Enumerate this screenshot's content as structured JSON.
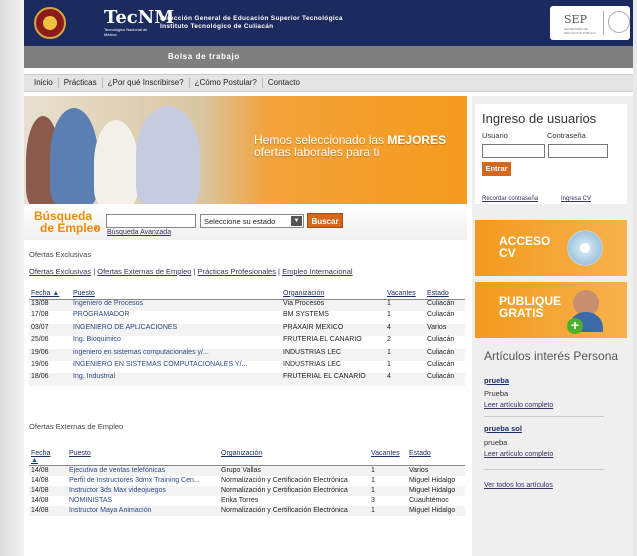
{
  "header": {
    "tecnm_mark": "TecNM",
    "tecnm_text": "Tecnológico Nacional de México",
    "title_line1": "Dirección General de Educación Superior Tecnológica",
    "title_line2": "Instituto Tecnológico de Culiacán",
    "sep_label": "SEP",
    "sep_sub": "SECRETARÍA DE EDUCACIÓN PÚBLICA"
  },
  "bolsa_title": "Bolsa de trabajo",
  "nav": [
    "Inicio",
    "Prácticas",
    "¿Por qué Inscribirse?",
    "¿Cómo Postular?",
    "Contacto"
  ],
  "banner": {
    "line1_prefix": "Hemos seleccionado las ",
    "line1_strong": "MEJORES",
    "line2": "ofertas laborales para ti"
  },
  "search": {
    "title_line1": "Búsqueda",
    "title_line2": "de Empleo",
    "chevron": "»",
    "advanced": "Búsqueda Avanzada",
    "state_placeholder": "Seleccione su estado",
    "button": "Buscar"
  },
  "exclusivas": {
    "title": "Ofertas Exclusivas",
    "filters": [
      "Ofertas Exclusivas",
      "Ofertas Externas de Empleo",
      "Prácticas Profesionales",
      "Empleo Internacional"
    ],
    "columns": [
      "Fecha",
      "Puesto",
      "Organización",
      "Vacantes",
      "Estado"
    ],
    "sort_arrow": "▲",
    "rows": [
      [
        "13/08",
        "Ingeniero de Procesos",
        "Via Procesos",
        "1",
        "Culiacán"
      ],
      [
        "17/08",
        "PROGRAMADOR",
        "BM SYSTEMS",
        "1",
        "Culiacán"
      ],
      [
        "03/07",
        "INGENIERO DE APLICACIONES",
        "PRAXAIR MEXICO",
        "4",
        "Varios"
      ],
      [
        "25/06",
        "Ing. Bioquimico",
        "FRUTERIA EL CANARIO",
        "2",
        "Culiacán"
      ],
      [
        "19/06",
        "ingeniero en sistemas computacionales y/...",
        "INDUSTRIAS LEC",
        "1",
        "Culiacán"
      ],
      [
        "19/06",
        "INGENIERO EN SISTEMAS COMPUTACIONALES Y/...",
        "INDUSTRIAS LEC",
        "1",
        "Culiacán"
      ],
      [
        "18/06",
        "Ing. Industrial",
        "FRUTERIAL EL CANARIO",
        "4",
        "Culiacán"
      ]
    ]
  },
  "externas": {
    "title": "Ofertas Externas de Empleo",
    "columns": [
      "Fecha",
      "Puesto",
      "Organización",
      "Vacantes",
      "Estado"
    ],
    "sort_arrow": "▲",
    "rows": [
      [
        "14/08",
        "Ejecutiva de ventas telefónicas",
        "Grupo Vallas",
        "1",
        "Varios"
      ],
      [
        "14/08",
        "Perfil de Instructores 3dmx Training Cen...",
        "Normalización y Certificación Electrónica",
        "1",
        "Miguel Hidalgo"
      ],
      [
        "14/08",
        "Instructor 3ds Max videojuegos",
        "Normalización y Certificación Electrónica",
        "1",
        "Miguel Hidalgo"
      ],
      [
        "14/08",
        "NOMINISTAS",
        "Erika Torres",
        "3",
        "Cuauhtémoc"
      ],
      [
        "14/08",
        "Instructor Maya Animación",
        "Normalización y Certificación Electrónica",
        "1",
        "Miguel Hidalgo"
      ]
    ]
  },
  "login": {
    "title": "Ingreso de usuarios",
    "user_label": "Usuario",
    "pass_label": "Contraseña",
    "button": "Entrar",
    "forgot": "Recordar contraseña",
    "cv": "Ingresa CV"
  },
  "promos": {
    "cv_line1": "ACCESO",
    "cv_line2": "CV",
    "pub_line1": "PUBLIQUE",
    "pub_line2": "GRATIS",
    "plus": "+"
  },
  "articles": {
    "title": "Artículos interés Persona",
    "items": [
      {
        "link": "prueba",
        "text": "Prueba",
        "read": "Leer artículo completo"
      },
      {
        "link": "prueba sol",
        "text": "prueba",
        "read": "Leer artículo completo"
      }
    ],
    "all": "Ver todos los artículos"
  },
  "colors": {
    "header_bg": "#1b2b5e",
    "accent_orange": "#f39a1e",
    "button_orange": "#d4661d"
  }
}
